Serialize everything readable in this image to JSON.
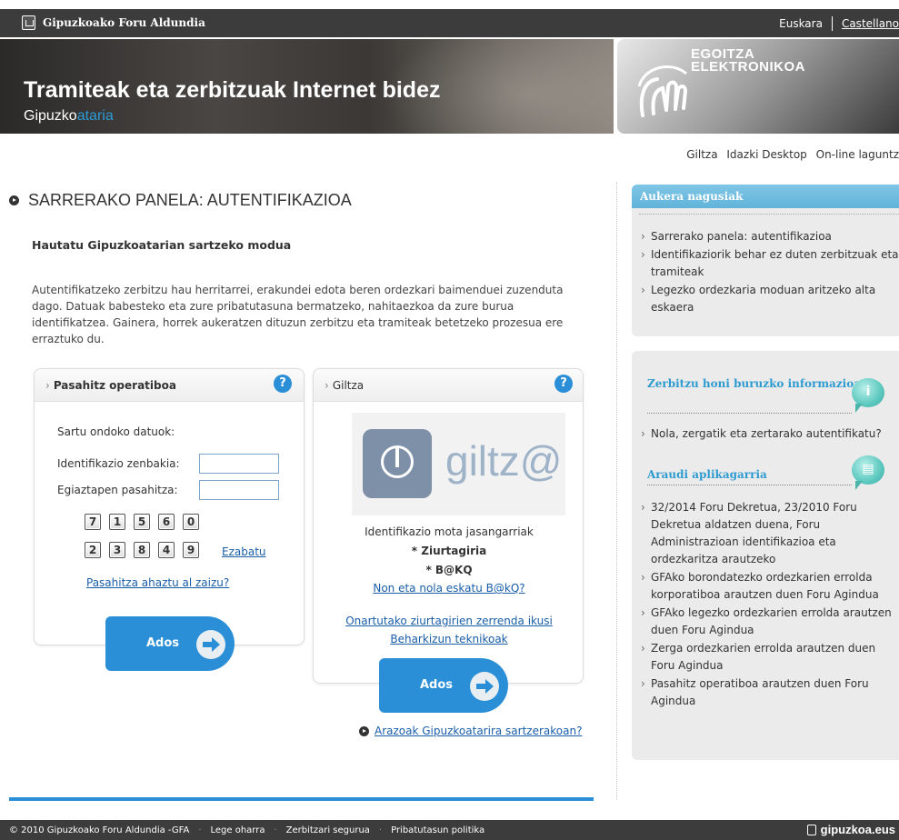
{
  "header": {
    "brand": "Gipuzkoako Foru Aldundia",
    "lang_eu": "Euskara",
    "lang_es": "Castellano"
  },
  "banner": {
    "title": "Tramiteak eta zerbitzuak Internet bidez",
    "subtitle_a": "Gipuzko",
    "subtitle_b": "ataria",
    "right_line1": "EGOITZA",
    "right_line2": "ELEKTRONIKOA"
  },
  "utils": [
    "Giltza",
    "Idazki Desktop",
    "On-line laguntz"
  ],
  "main": {
    "title": "SARRERAKO PANELA: AUTENTIFIKAZIOA",
    "subtitle": "Hautatu Gipuzkoatarian sartzeko modua",
    "intro": "Autentifikatzeko zerbitzu hau herritarrei, erakundei edota beren ordezkari baimenduei zuzenduta dago. Datuak babesteko eta zure pribatutasuna bermatzeko, nahitaezkoa da zure burua identifikatzea. Gainera, horrek aukeratzen dituzun zerbitzu eta tramiteak betetzeko prozesua ere erraztuko du."
  },
  "panel_pass": {
    "title": "Pasahitz operatiboa",
    "prompt": "Sartu ondoko datuok:",
    "id_label": "Identifikazio zenbakia:",
    "pw_label": "Egiaztapen pasahitza:",
    "id_value": "",
    "pw_value": "",
    "keys_row1": [
      "7",
      "1",
      "5",
      "6",
      "0"
    ],
    "keys_row2": [
      "2",
      "3",
      "8",
      "4",
      "9"
    ],
    "clear": "Ezabatu",
    "forgot": "Pasahitza ahaztu al zaizu?",
    "ok": "Ados"
  },
  "panel_giltza": {
    "title": "Giltza",
    "logo_text": "giltz@",
    "types_label": "Identifikazio mota jasangarriak",
    "type1": "* Ziurtagiria",
    "type2": "* B@KQ",
    "link_where": "Non eta nola eskatu B@kQ?",
    "link_certs": "Onartutako ziurtagirien zerrenda ikusi",
    "link_tech": "Beharkizun teknikoak",
    "ok": "Ados"
  },
  "trouble_link": "Arazoak Gipuzkoatarira sartzerakoan?",
  "sidebar": {
    "main_header": "Aukera nagusiak",
    "main_items": [
      "Sarrerako panela: autentifikazioa",
      "Identifikaziorik behar ez duten zerbitzuak eta tramiteak",
      "Legezko ordezkaria moduan aritzeko alta eskaera"
    ],
    "info_header": "Zerbitzu honi buruzko informazioa",
    "info_items": [
      "Nola, zergatik eta zertarako autentifikatu?"
    ],
    "law_header": "Araudi aplikagarria",
    "law_items": [
      "32/2014 Foru Dekretua, 23/2010 Foru Dekretua aldatzen duena, Foru Administrazioan identifikazioa eta ordezkaritza arautzeko",
      "GFAko borondatezko ordezkarien errolda korporatiboa arautzen duen Foru Agindua",
      "GFAko legezko ordezkarien errolda arautzen duen Foru Agindua",
      "Zerga ordezkarien errolda arautzen duen Foru Agindua",
      "Pasahitz operatiboa arautzen duen Foru Agindua"
    ]
  },
  "footer": {
    "copyright": "© 2010 Gipuzkoako Foru Aldundia -GFA",
    "legal": "Lege oharra",
    "secure": "Zerbitzari segurua",
    "privacy": "Pribatutasun politika",
    "brand": "gipuzkoa.eus"
  },
  "colors": {
    "accent_blue": "#2a8fd6",
    "sidebar_header": "#6cbbe0",
    "dark_bar": "#3c3c3c"
  }
}
